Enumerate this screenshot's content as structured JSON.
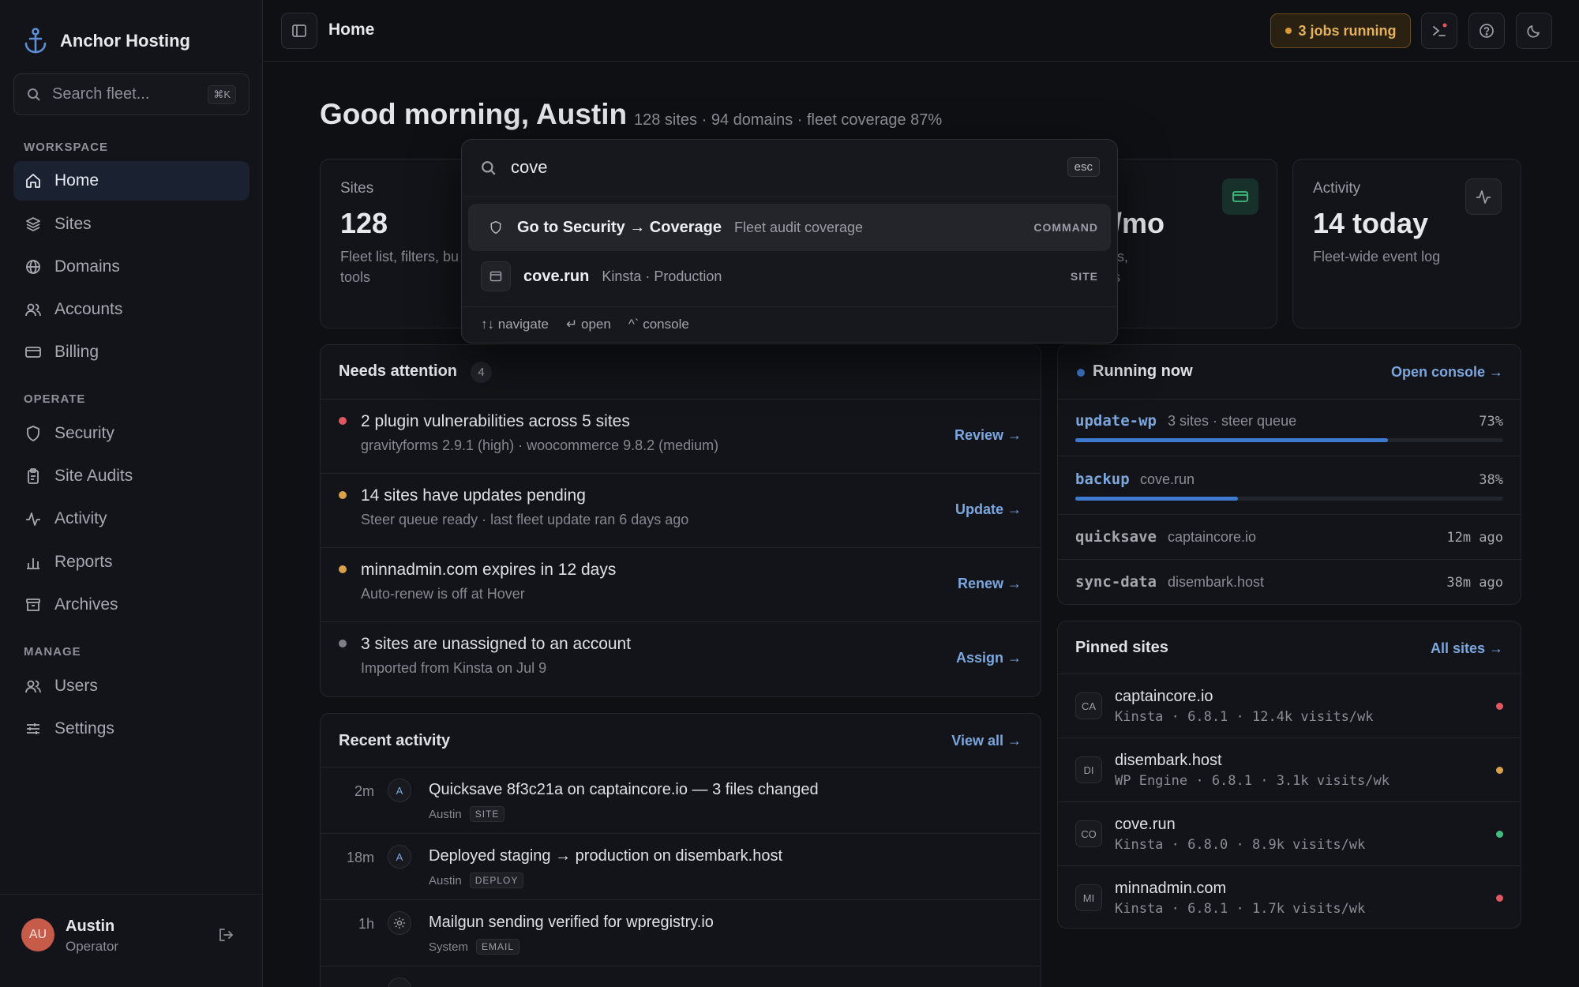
{
  "app": {
    "brand": "Anchor Hosting",
    "page": "Home"
  },
  "sidebar": {
    "search_placeholder": "Search fleet...",
    "search_shortcut": "⌘K",
    "sections": {
      "workspace": "WORKSPACE",
      "operate": "OPERATE",
      "manage": "MANAGE"
    },
    "items": [
      {
        "label": "Home",
        "icon": "home-icon",
        "active": true
      },
      {
        "label": "Sites",
        "icon": "layers-icon"
      },
      {
        "label": "Domains",
        "icon": "globe-icon"
      },
      {
        "label": "Accounts",
        "icon": "users-icon"
      },
      {
        "label": "Billing",
        "icon": "credit-card-icon"
      },
      {
        "label": "Security",
        "icon": "shield-icon"
      },
      {
        "label": "Site Audits",
        "icon": "clipboard-icon"
      },
      {
        "label": "Activity",
        "icon": "activity-icon"
      },
      {
        "label": "Reports",
        "icon": "bar-chart-icon"
      },
      {
        "label": "Archives",
        "icon": "archive-icon"
      },
      {
        "label": "Users",
        "icon": "users-icon"
      },
      {
        "label": "Settings",
        "icon": "sliders-icon"
      }
    ],
    "user": {
      "initials": "AU",
      "name": "Austin",
      "role": "Operator"
    }
  },
  "topbar": {
    "jobs_label": "3 jobs running"
  },
  "greeting": {
    "title": "Good morning, Austin",
    "subtitle": "128 sites · 94 domains · fleet coverage 87%"
  },
  "stats": [
    {
      "label": "Sites",
      "value": "128",
      "desc_line1": "Fleet list, filters, bu",
      "desc_line2": "tools"
    },
    {
      "label": "",
      "value": "4k/mo",
      "desc_line1": ", plans,",
      "desc_line2": "ptions"
    },
    {
      "label": "Activity",
      "value": "14 today",
      "desc_line1": "Fleet-wide event log",
      "desc_line2": ""
    }
  ],
  "attention": {
    "title": "Needs attention",
    "count": "4",
    "items": [
      {
        "title": "2 plugin vulnerabilities across 5 sites",
        "sub": "gravityforms 2.9.1 (high) · woocommerce 9.8.2 (medium)",
        "action": "Review →",
        "color": "#e0575f"
      },
      {
        "title": "14 sites have updates pending",
        "sub": "Steer queue ready · last fleet update ran 6 days ago",
        "action": "Update →",
        "color": "#d9a14a"
      },
      {
        "title": "minnadmin.com expires in 12 days",
        "sub": "Auto-renew is off at Hover",
        "action": "Renew →",
        "color": "#d9a14a"
      },
      {
        "title": "3 sites are unassigned to an account",
        "sub": "Imported from Kinsta on Jul 9",
        "action": "Assign →",
        "color": "#7d8089"
      }
    ]
  },
  "activity": {
    "title": "Recent activity",
    "view_all": "View all →",
    "items": [
      {
        "time": "2m",
        "badge": "A",
        "title": "Quicksave 8f3c21a on captaincore.io — 3 files changed",
        "who": "Austin",
        "tag": "SITE"
      },
      {
        "time": "18m",
        "badge": "A",
        "title": "Deployed staging → production on disembark.host",
        "who": "Austin",
        "tag": "DEPLOY"
      },
      {
        "time": "1h",
        "badge": "",
        "title": "Mailgun sending verified for wpregistry.io",
        "who": "System",
        "tag": "EMAIL"
      },
      {
        "time": "",
        "badge": "",
        "title": "",
        "who": "",
        "tag": ""
      }
    ]
  },
  "running": {
    "title": "Running now",
    "link": "Open console →",
    "jobs": [
      {
        "name": "update-wp",
        "meta": "3 sites · steer queue",
        "right": "73%",
        "progress": 0.73,
        "active": true
      },
      {
        "name": "backup",
        "meta": "cove.run",
        "right": "38%",
        "progress": 0.38,
        "active": true
      },
      {
        "name": "quicksave",
        "meta": "captaincore.io",
        "right": "12m ago",
        "active": false
      },
      {
        "name": "sync-data",
        "meta": "disembark.host",
        "right": "38m ago",
        "active": false
      }
    ]
  },
  "pinned": {
    "title": "Pinned sites",
    "link": "All sites →",
    "sites": [
      {
        "badge": "CA",
        "name": "captaincore.io",
        "meta": "Kinsta · 6.8.1 · 12.4k visits/wk",
        "status_color": "#e0575f"
      },
      {
        "badge": "DI",
        "name": "disembark.host",
        "meta": "WP Engine · 6.8.1 · 3.1k visits/wk",
        "status_color": "#d9a14a"
      },
      {
        "badge": "CO",
        "name": "cove.run",
        "meta": "Kinsta · 6.8.0 · 8.9k visits/wk",
        "status_color": "#3fbf7f"
      },
      {
        "badge": "MI",
        "name": "minnadmin.com",
        "meta": "Kinsta · 6.8.1 · 1.7k visits/wk",
        "status_color": "#e0575f"
      }
    ]
  },
  "palette": {
    "query": "cove",
    "esc": "esc",
    "results": [
      {
        "title": "Go to Security → Coverage",
        "sub": "Fleet audit coverage",
        "kind": "COMMAND",
        "icon": "shield-icon"
      },
      {
        "title": "cove.run",
        "sub": "Kinsta · Production",
        "kind": "SITE",
        "icon": "browser-icon"
      }
    ],
    "footer": {
      "navigate": "navigate",
      "open": "open",
      "console": "console"
    }
  },
  "colors": {
    "accent": "#3f7ad1",
    "link": "#7ba7de",
    "warning": "#d9a14a",
    "danger": "#e0575f",
    "success": "#3fbf7f"
  }
}
